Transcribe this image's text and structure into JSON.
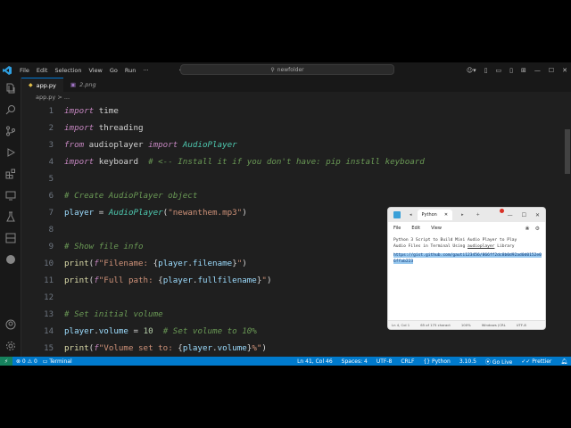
{
  "titlebar": {
    "menus": [
      "File",
      "Edit",
      "Selection",
      "View",
      "Go",
      "Run",
      "···"
    ],
    "search": "newfolder"
  },
  "tabs": [
    {
      "label": "app.py",
      "active": true
    },
    {
      "label": "2.png",
      "active": false
    }
  ],
  "breadcrumb": "app.py > ...",
  "editor": {
    "line_numbers": [
      "1",
      "2",
      "3",
      "4",
      "5",
      "6",
      "7",
      "8",
      "9",
      "10",
      "11",
      "12",
      "13",
      "14",
      "15"
    ]
  },
  "statusbar": {
    "problems": "⊗ 0 ⚠ 0",
    "terminal": "Terminal",
    "position": "Ln 41, Col 46",
    "spaces": "Spaces: 4",
    "encoding": "UTF-8",
    "eol": "CRLF",
    "language": "Python",
    "version": "3.10.5",
    "golive": "Go Live",
    "prettier": "Prettier"
  },
  "notepad": {
    "tab_label": "Python",
    "menus": [
      "File",
      "Edit",
      "View"
    ],
    "text_line1": "Python 3 Script to Build Mini Audio Player to Play",
    "text_line2_a": "Audio Files in Terminal Using ",
    "text_line2_link": "audioplayer",
    "text_line2_b": " Library",
    "selected_url": "https://gist.github.com/gauti123456/866ff2dc8b0d92ad0d0152e06ffab223",
    "status": [
      "Ln 4, Col 1",
      "65 of 175 charact",
      "100%",
      "Windows (CRL",
      "UTF-8"
    ]
  },
  "colors": {
    "accent": "#007acc",
    "keyword": "#c586c0",
    "class": "#4ec9b0",
    "string": "#ce9178",
    "comment": "#6a9955"
  }
}
